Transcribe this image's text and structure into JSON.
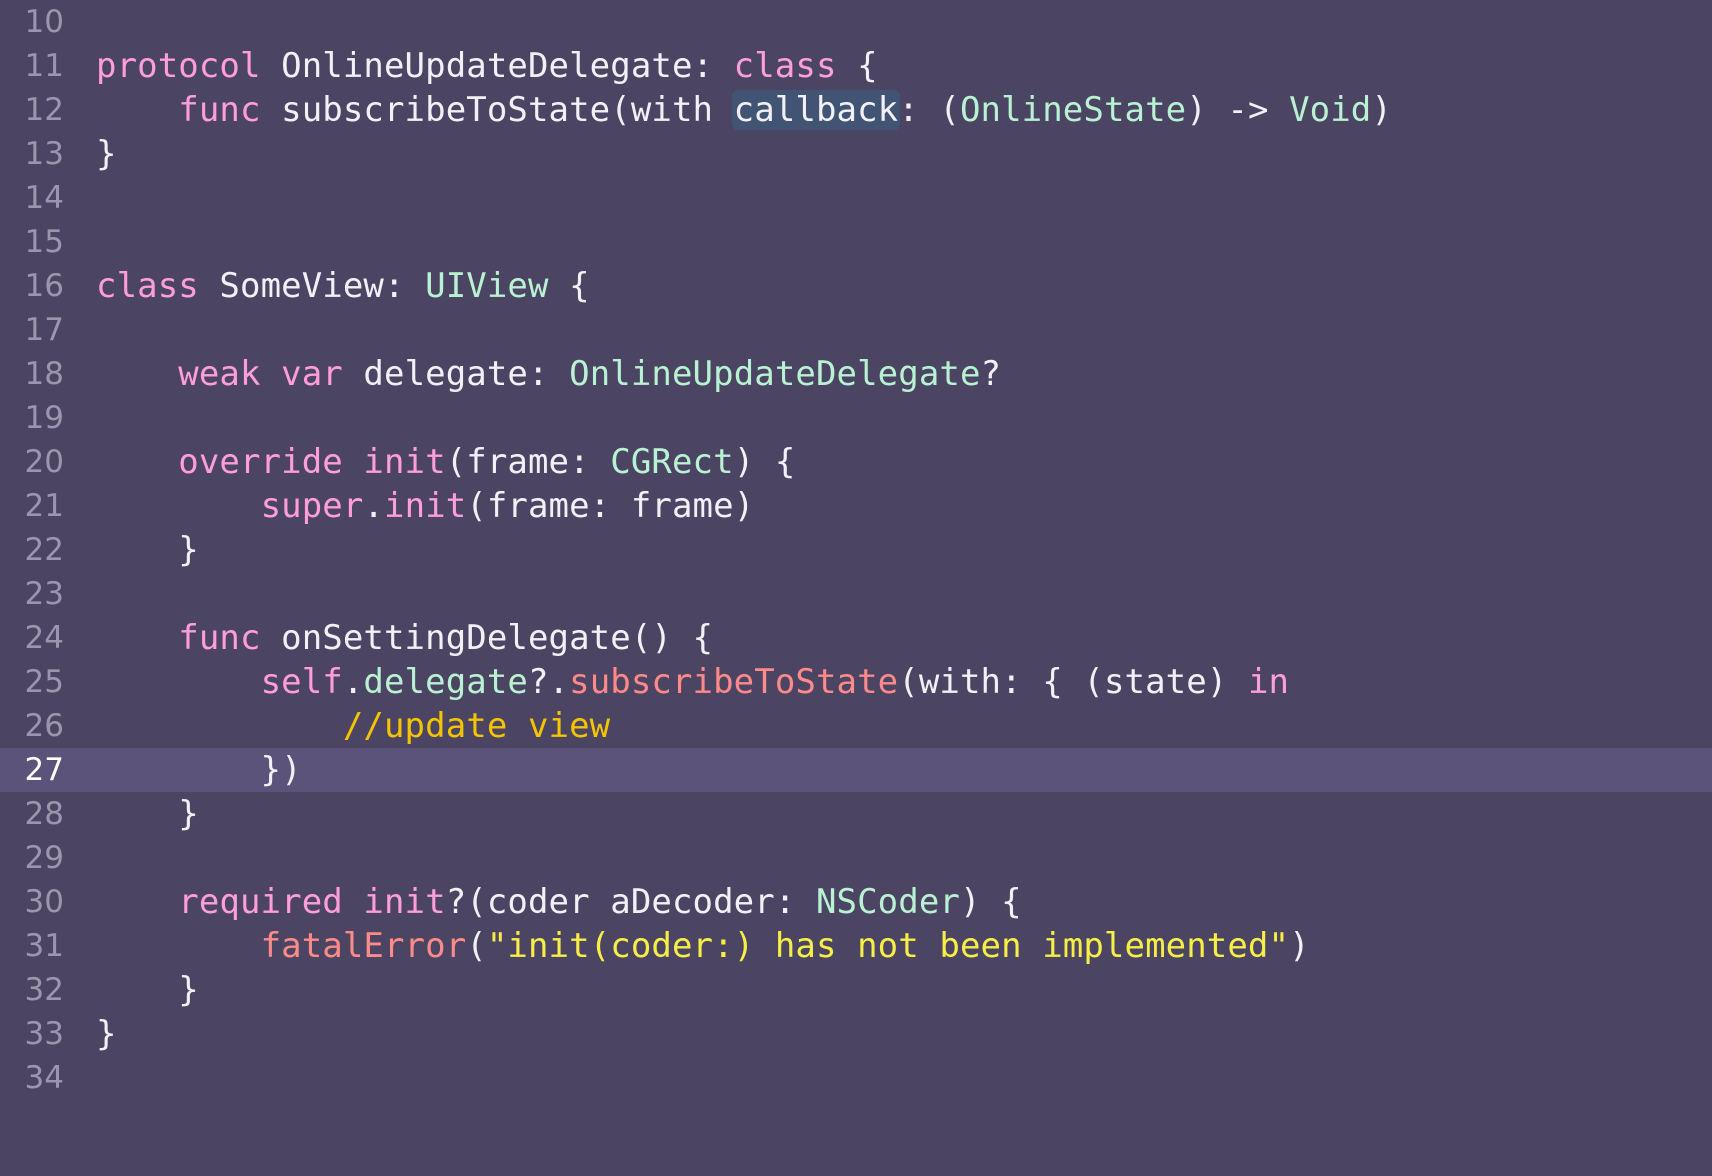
{
  "editor": {
    "current_line": 27,
    "highlight_word": "callback",
    "lines": [
      {
        "n": "10",
        "tokens": []
      },
      {
        "n": "11",
        "tokens": [
          {
            "t": "protocol",
            "c": "kw"
          },
          {
            "t": " OnlineUpdateDelegate: ",
            "c": "pl"
          },
          {
            "t": "class",
            "c": "kw"
          },
          {
            "t": " {",
            "c": "pl"
          }
        ]
      },
      {
        "n": "12",
        "tokens": [
          {
            "t": "    ",
            "c": "pl"
          },
          {
            "t": "func",
            "c": "kw"
          },
          {
            "t": " subscribeToState(with ",
            "c": "pl"
          },
          {
            "t": "callback",
            "c": "pl",
            "hl": true
          },
          {
            "t": ": (",
            "c": "pl"
          },
          {
            "t": "OnlineState",
            "c": "ty"
          },
          {
            "t": ") -> ",
            "c": "pl"
          },
          {
            "t": "Void",
            "c": "ty"
          },
          {
            "t": ")",
            "c": "pl"
          }
        ]
      },
      {
        "n": "13",
        "tokens": [
          {
            "t": "}",
            "c": "pl"
          }
        ]
      },
      {
        "n": "14",
        "tokens": []
      },
      {
        "n": "15",
        "tokens": []
      },
      {
        "n": "16",
        "tokens": [
          {
            "t": "class",
            "c": "kw"
          },
          {
            "t": " SomeView: ",
            "c": "pl"
          },
          {
            "t": "UIView",
            "c": "ty"
          },
          {
            "t": " {",
            "c": "pl"
          }
        ]
      },
      {
        "n": "17",
        "tokens": []
      },
      {
        "n": "18",
        "tokens": [
          {
            "t": "    ",
            "c": "pl"
          },
          {
            "t": "weak",
            "c": "kw"
          },
          {
            "t": " ",
            "c": "pl"
          },
          {
            "t": "var",
            "c": "kw"
          },
          {
            "t": " delegate: ",
            "c": "pl"
          },
          {
            "t": "OnlineUpdateDelegate",
            "c": "ty"
          },
          {
            "t": "?",
            "c": "pl"
          }
        ]
      },
      {
        "n": "19",
        "tokens": []
      },
      {
        "n": "20",
        "tokens": [
          {
            "t": "    ",
            "c": "pl"
          },
          {
            "t": "override",
            "c": "kw"
          },
          {
            "t": " ",
            "c": "pl"
          },
          {
            "t": "init",
            "c": "kw"
          },
          {
            "t": "(frame: ",
            "c": "pl"
          },
          {
            "t": "CGRect",
            "c": "ty"
          },
          {
            "t": ") {",
            "c": "pl"
          }
        ]
      },
      {
        "n": "21",
        "tokens": [
          {
            "t": "        ",
            "c": "pl"
          },
          {
            "t": "super",
            "c": "kw"
          },
          {
            "t": ".",
            "c": "pl"
          },
          {
            "t": "init",
            "c": "kw"
          },
          {
            "t": "(frame: frame)",
            "c": "pl"
          }
        ]
      },
      {
        "n": "22",
        "tokens": [
          {
            "t": "    }",
            "c": "pl"
          }
        ]
      },
      {
        "n": "23",
        "tokens": []
      },
      {
        "n": "24",
        "tokens": [
          {
            "t": "    ",
            "c": "pl"
          },
          {
            "t": "func",
            "c": "kw"
          },
          {
            "t": " onSettingDelegate() {",
            "c": "pl"
          }
        ]
      },
      {
        "n": "25",
        "tokens": [
          {
            "t": "        ",
            "c": "pl"
          },
          {
            "t": "self",
            "c": "kw"
          },
          {
            "t": ".",
            "c": "pl"
          },
          {
            "t": "delegate",
            "c": "ty"
          },
          {
            "t": "?.",
            "c": "pl"
          },
          {
            "t": "subscribeToState",
            "c": "fn"
          },
          {
            "t": "(with: { (state) ",
            "c": "pl"
          },
          {
            "t": "in",
            "c": "kw"
          }
        ]
      },
      {
        "n": "26",
        "tokens": [
          {
            "t": "            ",
            "c": "pl"
          },
          {
            "t": "//update view",
            "c": "cm"
          }
        ]
      },
      {
        "n": "27",
        "tokens": [
          {
            "t": "        })",
            "c": "pl"
          }
        ]
      },
      {
        "n": "28",
        "tokens": [
          {
            "t": "    }",
            "c": "pl"
          }
        ]
      },
      {
        "n": "29",
        "tokens": []
      },
      {
        "n": "30",
        "tokens": [
          {
            "t": "    ",
            "c": "pl"
          },
          {
            "t": "required",
            "c": "kw"
          },
          {
            "t": " ",
            "c": "pl"
          },
          {
            "t": "init",
            "c": "kw"
          },
          {
            "t": "?(coder aDecoder: ",
            "c": "pl"
          },
          {
            "t": "NSCoder",
            "c": "ty"
          },
          {
            "t": ") {",
            "c": "pl"
          }
        ]
      },
      {
        "n": "31",
        "tokens": [
          {
            "t": "        ",
            "c": "pl"
          },
          {
            "t": "fatalError",
            "c": "fn"
          },
          {
            "t": "(",
            "c": "pl"
          },
          {
            "t": "\"init(coder:) has not been implemented\"",
            "c": "st"
          },
          {
            "t": ")",
            "c": "pl"
          }
        ]
      },
      {
        "n": "32",
        "tokens": [
          {
            "t": "    }",
            "c": "pl"
          }
        ]
      },
      {
        "n": "33",
        "tokens": [
          {
            "t": "}",
            "c": "pl"
          }
        ]
      },
      {
        "n": "34",
        "tokens": []
      }
    ]
  }
}
